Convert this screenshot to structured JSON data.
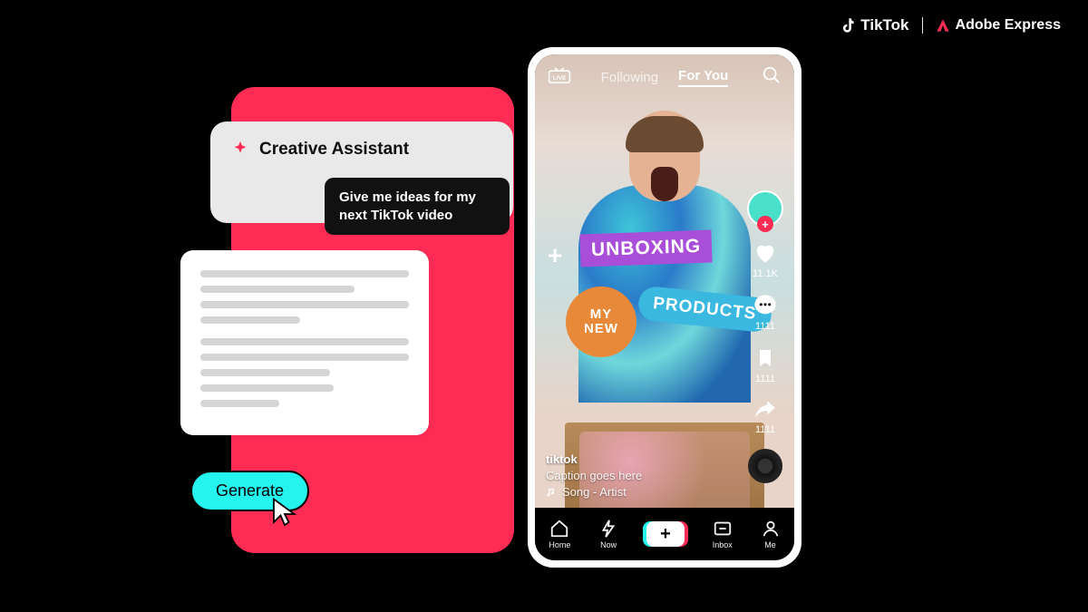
{
  "branding": {
    "tiktok": "TikTok",
    "adobe": "Adobe Express"
  },
  "assistant": {
    "title": "Creative Assistant",
    "prompt": "Give me ideas for my next TikTok video",
    "generate_label": "Generate"
  },
  "phone": {
    "topbar": {
      "following": "Following",
      "foryou": "For You"
    },
    "stickers": {
      "unboxing": "UNBOXING",
      "mynew_line1": "MY",
      "mynew_line2": "NEW",
      "products": "PRODUCTS"
    },
    "rail": {
      "likes": "11.1K",
      "comments": "1111",
      "saves": "1111",
      "shares": "1111"
    },
    "caption": {
      "user": "tiktok",
      "text": "Caption goes here",
      "music": "Song - Artist"
    },
    "nav": {
      "home": "Home",
      "now": "Now",
      "inbox": "Inbox",
      "me": "Me"
    }
  }
}
